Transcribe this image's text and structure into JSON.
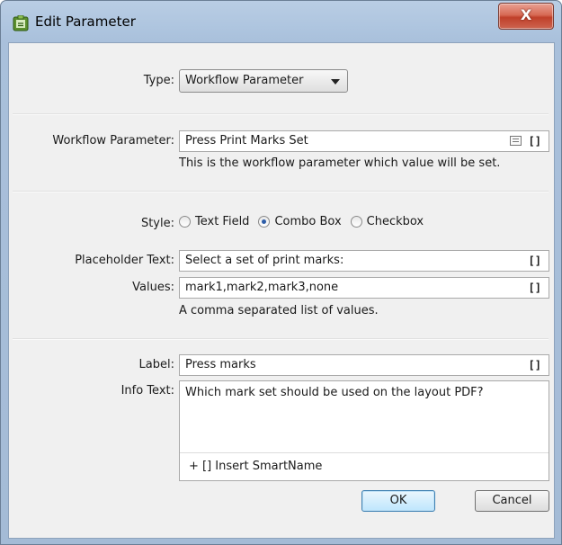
{
  "window": {
    "title": "Edit Parameter",
    "close_label": "X"
  },
  "type_row": {
    "label": "Type:",
    "value": "Workflow Parameter"
  },
  "workflow_param": {
    "label": "Workflow Parameter:",
    "value": "Press Print Marks Set",
    "bracket": "[]",
    "help": "This is the workflow parameter which value will be set."
  },
  "style": {
    "label": "Style:",
    "options": [
      "Text Field",
      "Combo Box",
      "Checkbox"
    ],
    "selected": "Combo Box"
  },
  "placeholder": {
    "label": "Placeholder Text:",
    "value": "Select a set of print marks:",
    "bracket": "[]"
  },
  "values": {
    "label": "Values:",
    "value": "mark1,mark2,mark3,none",
    "bracket": "[]",
    "help": "A comma separated list of values."
  },
  "label_field": {
    "label": "Label:",
    "value": "Press marks",
    "bracket": "[]"
  },
  "info_text": {
    "label": "Info Text:",
    "value": "Which mark set should be used on the layout PDF?",
    "insert_label": "+ [] Insert SmartName"
  },
  "buttons": {
    "ok": "OK",
    "cancel": "Cancel"
  }
}
